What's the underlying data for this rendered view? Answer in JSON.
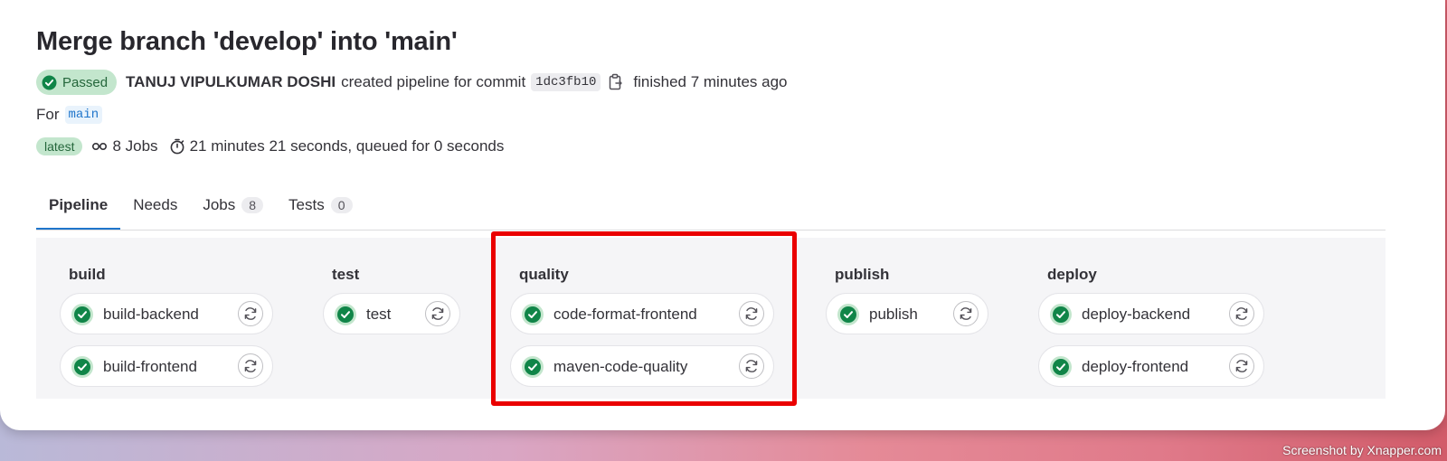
{
  "pipeline": {
    "title": "Merge branch 'develop' into 'main'",
    "status_label": "Passed",
    "author": "TANUJ VIPULKUMAR DOSHI",
    "created_text": "created pipeline for commit",
    "commit_sha": "1dc3fb10",
    "finished_text": "finished 7 minutes ago",
    "for_label": "For",
    "branch": "main",
    "latest_badge": "latest",
    "jobs_text": "8 Jobs",
    "duration_text": "21 minutes 21 seconds, queued for 0 seconds"
  },
  "tabs": [
    {
      "label": "Pipeline",
      "count": null,
      "active": true
    },
    {
      "label": "Needs",
      "count": null,
      "active": false
    },
    {
      "label": "Jobs",
      "count": "8",
      "active": false
    },
    {
      "label": "Tests",
      "count": "0",
      "active": false
    }
  ],
  "stages": [
    {
      "name": "build",
      "jobs": [
        "build-backend",
        "build-frontend"
      ]
    },
    {
      "name": "test",
      "jobs": [
        "test"
      ]
    },
    {
      "name": "quality",
      "jobs": [
        "code-format-frontend",
        "maven-code-quality"
      ]
    },
    {
      "name": "publish",
      "jobs": [
        "publish"
      ]
    },
    {
      "name": "deploy",
      "jobs": [
        "deploy-backend",
        "deploy-frontend"
      ]
    }
  ],
  "icons": {
    "job_status": "check-circle-icon",
    "retry": "retry-icon",
    "copy": "clipboard-icon",
    "jobs": "pipeline-jobs-icon",
    "duration": "timer-icon"
  },
  "colors": {
    "success": "#108548",
    "success_bg": "#c3e6cd",
    "link": "#1f75cb",
    "highlight": "#ea0000"
  },
  "watermark": "Screenshot by Xnapper.com"
}
